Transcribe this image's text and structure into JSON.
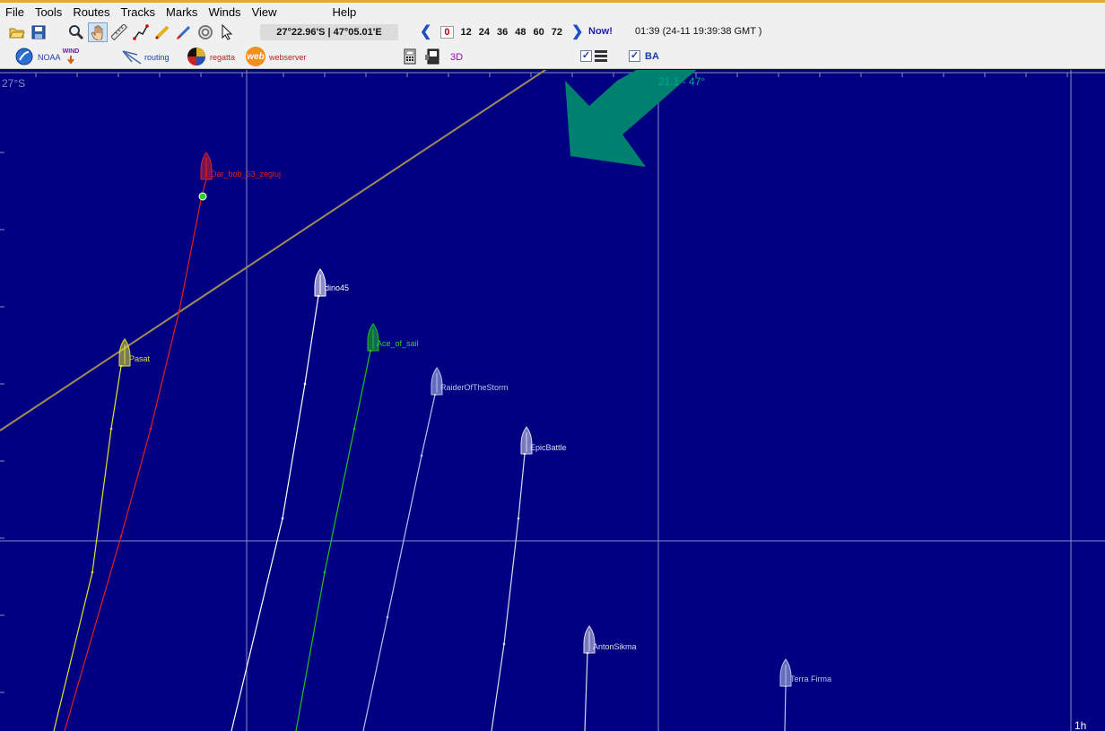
{
  "menu": [
    "File",
    "Tools",
    "Routes",
    "Tracks",
    "Marks",
    "Winds",
    "View",
    "Help"
  ],
  "toolbar": {
    "icons": [
      "open-folder-icon",
      "save-icon",
      "zoom-icon",
      "pan-hand-icon",
      "ruler-icon",
      "route-icon",
      "pencil-icon",
      "paint-icon",
      "target-icon",
      "pointer-icon"
    ],
    "coordinates": "27°22.96'S | 47°05.01'E",
    "hours": [
      "0",
      "12",
      "24",
      "36",
      "48",
      "60",
      "72"
    ],
    "selected_hour": "0",
    "now_label": "Now!",
    "time_display": "01:39 (24-11 19:39:38 GMT )"
  },
  "toolbar2": {
    "noaa_label": "NOAA",
    "wind_label": "WIND",
    "routing_label": "routing",
    "regatta_label": "regatta",
    "web_icon_label": "web",
    "webserver_label": "webserver",
    "three_d_label": "3D",
    "ba_label": "BA",
    "checkbox_mark": "✓"
  },
  "map": {
    "lat_label": "27°S",
    "wind_label": "21.1 - 47°",
    "scale_label": "1h",
    "colors": {
      "sea": "#000080",
      "grid": "#8a8ac8",
      "route": "#a08a5a",
      "wind_arrow": "#00806e"
    },
    "boats": [
      {
        "name": "Dar_bob_63_zegluj",
        "color": "#e02020",
        "label_color": "#e02020"
      },
      {
        "name": "dino45",
        "color": "#ffffff",
        "label_color": "#ffffff"
      },
      {
        "name": "Pasat",
        "color": "#e0e030",
        "label_color": "#e0e030"
      },
      {
        "name": "Ace_of_sail",
        "color": "#20c020",
        "label_color": "#30d030"
      },
      {
        "name": "RaiderOfTheStorm",
        "color": "#b8c4f0",
        "label_color": "#b8c4f0"
      },
      {
        "name": "EpicBattle",
        "color": "#dcdcf0",
        "label_color": "#dcdcf0"
      },
      {
        "name": "AntonSikma",
        "color": "#dcdcf0",
        "label_color": "#dcdcf0"
      },
      {
        "name": "Terra Firma",
        "color": "#b8c4f0",
        "label_color": "#b8c4f0"
      }
    ]
  }
}
